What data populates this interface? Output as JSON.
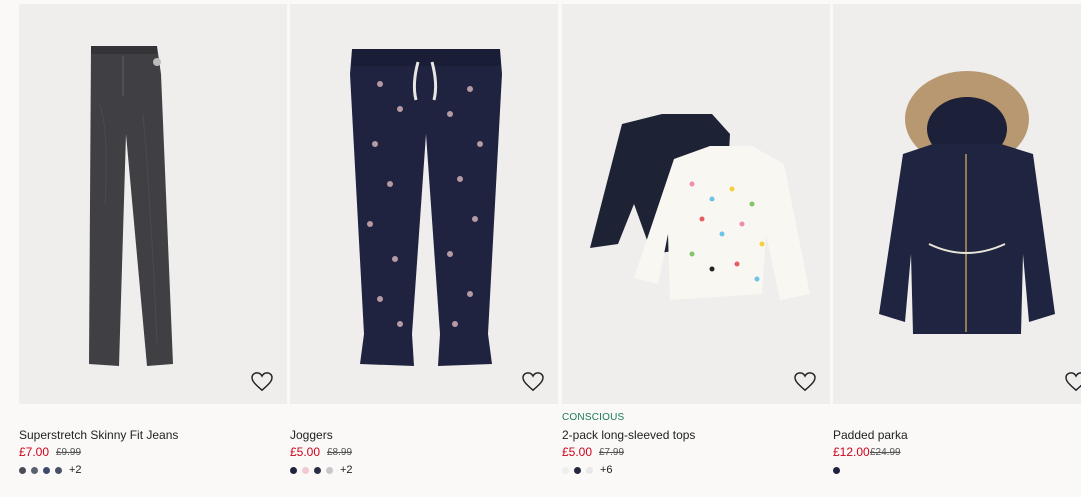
{
  "products": [
    {
      "title": "Superstretch Skinny Fit Jeans",
      "tag": "",
      "price": "£7.00",
      "old_price": "£9.99",
      "swatches": [
        "#4c4c58",
        "#5a6070",
        "#3d4a6b",
        "#4a4f6a"
      ],
      "more": "+2",
      "image": "dark-grey-skinny-jeans"
    },
    {
      "title": "Joggers",
      "tag": "",
      "price": "£5.00",
      "old_price": "£8.99",
      "swatches": [
        "#1f2340",
        "#f0c9d2",
        "#2b2e45",
        "#c8c8c8"
      ],
      "more": "+2",
      "image": "navy-unicorn-joggers"
    },
    {
      "title": "2-pack long-sleeved tops",
      "tag": "CONSCIOUS",
      "price": "£5.00",
      "old_price": "£7.99",
      "swatches": [
        "#eeeeee",
        "#25283f",
        "#e8e8e8"
      ],
      "more": "+6",
      "image": "two-long-sleeved-tops"
    },
    {
      "title": "Padded parka",
      "tag": "",
      "price": "£12.00",
      "old_price": "£24.99",
      "swatches": [
        "#1e2340"
      ],
      "more": "",
      "image": "navy-padded-parka"
    }
  ],
  "colors": {
    "sale_price": "#d0021b",
    "conscious_tag": "#1b7a5a",
    "image_bg": "#efeeec"
  },
  "icons": {
    "favourite": "heart-outline-icon"
  }
}
